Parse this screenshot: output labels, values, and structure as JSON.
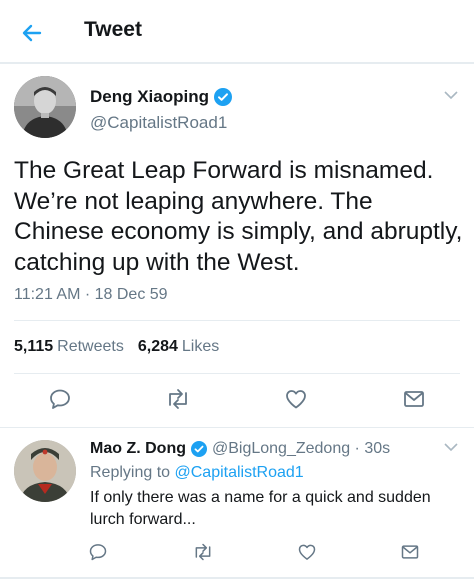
{
  "header": {
    "title": "Tweet"
  },
  "tweet": {
    "author_name": "Deng Xiaoping",
    "author_handle": "@CapitalistRoad1",
    "text": "The Great Leap Forward is misnamed. We’re not leaping anywhere. The Chinese economy is simply, and abruptly, catching up with the West.",
    "timestamp": "11:21 AM · 18 Dec 59",
    "retweets_count": "5,115",
    "retweets_label": "Retweets",
    "likes_count": "6,284",
    "likes_label": "Likes"
  },
  "reply": {
    "author_name": "Mao Z. Dong",
    "author_handle": "@BigLong_Zedong · 30s",
    "replying_prefix": "Replying to",
    "replying_handle": "@CapitalistRoad1",
    "text": "If only there was a name for a quick and sudden lurch forward..."
  },
  "icons": {
    "back": "arrow-left-icon",
    "verified": "verified-badge-icon",
    "more": "chevron-down-icon",
    "reply": "comment-icon",
    "retweet": "retweet-icon",
    "like": "heart-icon",
    "share": "mail-icon"
  },
  "colors": {
    "accent": "#1da1f2",
    "text": "#14171a",
    "muted": "#657786",
    "border": "#e6ecf0"
  }
}
